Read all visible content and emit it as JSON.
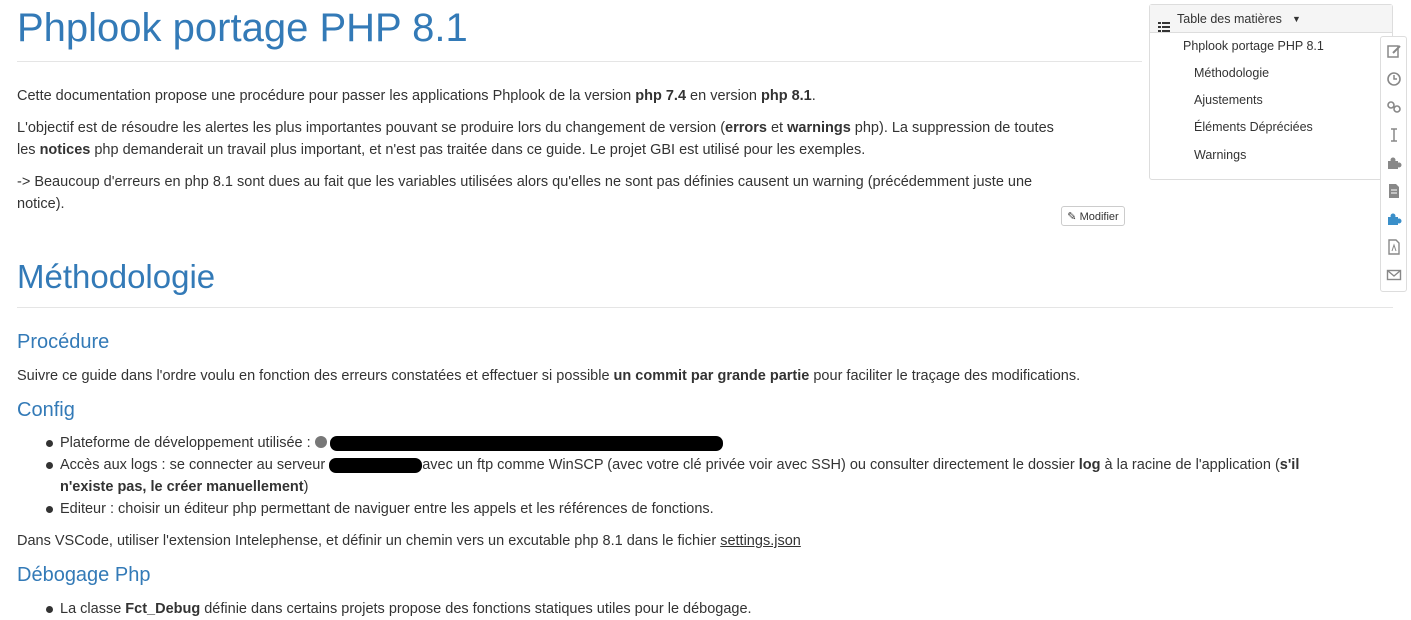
{
  "title": "Phplook portage PHP 8.1",
  "intro": {
    "p1": {
      "a": "Cette documentation propose une procédure pour passer les applications Phplook de la version ",
      "b1": "php 7.4",
      "c": " en version ",
      "b2": "php 8.1",
      "d": "."
    },
    "p2": {
      "a": "L'objectif est de résoudre les alertes les plus importantes pouvant se produire lors du changement de version (",
      "b1": "errors",
      "c": " et ",
      "b2": "warnings",
      "d": " php). La suppression de toutes",
      "e": "les ",
      "b3": "notices",
      "f": " php demanderait un travail plus important, et n'est pas traitée dans ce guide. Le projet GBI est utilisé pour les exemples."
    },
    "p3": {
      "line1": "-> Beaucoup d'erreurs en php 8.1 sont dues au fait que les variables utilisées alors qu'elles ne sont pas définies causent un warning (précédemment juste une",
      "line2": "notice)."
    }
  },
  "edit_button": "Modifier",
  "methodologie": {
    "heading": "Méthodologie",
    "procedure": {
      "heading": "Procédure",
      "a": "Suivre ce guide dans l'ordre voulu en fonction des erreurs constatées et effectuer si possible ",
      "b": "un commit par grande partie",
      "c": " pour faciliter le traçage des modifications."
    },
    "config": {
      "heading": "Config",
      "item1": "Plateforme de développement utilisée : ",
      "item2": {
        "a": "Accès aux logs : se connecter au serveur ",
        "b": "avec un ftp comme WinSCP (avec votre clé privée voir avec SSH) ou consulter directement le dossier ",
        "c": "log",
        "d": " à la racine de l'application (",
        "e": "s'il",
        "f": "n'existe pas, le créer manuellement",
        "g": ")"
      },
      "item3": "Editeur : choisir un éditeur php permettant de naviguer entre les appels et les références de fonctions.",
      "vscode": {
        "a": "Dans VSCode, utiliser l'extension Intelephense, et définir un chemin vers un excutable php 8.1 dans le fichier ",
        "link": "settings.json"
      }
    },
    "debug": {
      "heading": "Débogage Php",
      "item1": {
        "a": "La classe ",
        "b": "Fct_Debug",
        "c": " définie dans certains projets propose des fonctions statiques utiles pour le débogage."
      }
    }
  },
  "toc": {
    "header": "Table des matières",
    "items": [
      "Phplook portage PHP 8.1",
      "Méthodologie",
      "Ajustements",
      "Éléments Dépréciées",
      "Warnings"
    ]
  },
  "sidebar_icons": [
    "edit-icon",
    "history-icon",
    "link-icon",
    "text-cursor-icon",
    "plugin-icon",
    "document-icon",
    "plugin-active-icon",
    "pdf-icon",
    "mail-icon"
  ],
  "colors": {
    "heading": "#337ab7",
    "text": "#333333",
    "redaction": "#000000"
  }
}
